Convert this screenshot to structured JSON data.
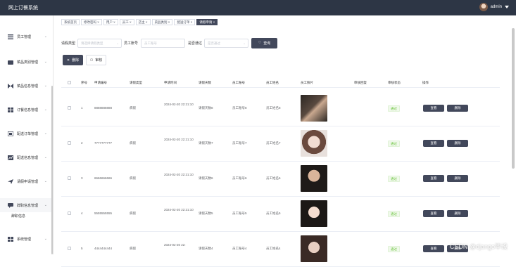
{
  "app": {
    "title": "网上订餐系统",
    "user": "admin"
  },
  "sidebar": {
    "items": [
      {
        "label": "员工管理",
        "icon": "menu-icon"
      },
      {
        "label": "菜品类别管理",
        "icon": "food-icon"
      },
      {
        "label": "菜品信息管理",
        "icon": "dish-icon"
      },
      {
        "label": "订餐信息管理",
        "icon": "grid-icon"
      },
      {
        "label": "配送订单管理",
        "icon": "delivery-icon"
      },
      {
        "label": "配送信息管理",
        "icon": "chart-icon"
      },
      {
        "label": "请假申请管理",
        "icon": "send-icon"
      },
      {
        "label": "辞职信息管理",
        "icon": "chat-icon"
      },
      {
        "label": "系统管理",
        "icon": "apps-icon"
      }
    ],
    "sub_item": "辞职信息"
  },
  "tabs": [
    "系统首页",
    "修改密码",
    "用户",
    "员工",
    "店主",
    "菜品类别",
    "配送订单",
    "请假申请"
  ],
  "filters": {
    "type_label": "请假类型",
    "type_placeholder": "请选择请假类型",
    "no_label": "员工账号",
    "no_placeholder": "员工账号",
    "pass_label": "是否通过",
    "pass_placeholder": "是否通过",
    "search_btn": "查询"
  },
  "actions": {
    "delete": "删除",
    "review": "审核"
  },
  "table": {
    "headers": [
      "序号",
      "申请编号",
      "请假类型",
      "申请时间",
      "请假天数",
      "员工账号",
      "员工姓名",
      "员工照片",
      "审核回复",
      "审核状态",
      "操作"
    ],
    "rows": [
      {
        "idx": "1",
        "no": "8888888888",
        "type": "病假",
        "time": "2024-02-20 22:21:10",
        "days": "请假天数8",
        "acct": "员工账号8",
        "name": "员工姓名8",
        "status": "通过"
      },
      {
        "idx": "2",
        "no": "7777777777",
        "type": "病假",
        "time": "2024-02-20 22:21:10",
        "days": "请假天数7",
        "acct": "员工账号7",
        "name": "员工姓名7",
        "status": "通过"
      },
      {
        "idx": "3",
        "no": "6666666666",
        "type": "病假",
        "time": "2024-02-20 22:21:10",
        "days": "请假天数6",
        "acct": "员工账号6",
        "name": "员工姓名6",
        "status": "通过"
      },
      {
        "idx": "4",
        "no": "5555555555",
        "type": "病假",
        "time": "2024-02-20 22:21:10",
        "days": "请假天数5",
        "acct": "员工账号5",
        "name": "员工姓名5",
        "status": "通过"
      },
      {
        "idx": "5",
        "no": "4444444444",
        "type": "病假",
        "time": "2024-02-20 22:",
        "days": "请假天数4",
        "acct": "员工账号4",
        "name": "员工姓名4",
        "status": "通过"
      }
    ],
    "view_btn": "查看",
    "del_btn": "删除"
  },
  "watermark": "CSDN @django毕设"
}
